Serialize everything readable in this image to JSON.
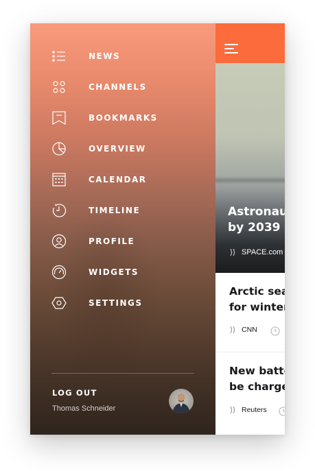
{
  "app": {
    "accent_color": "#fb6b3b"
  },
  "drawer": {
    "items": [
      {
        "label": "NEWS",
        "icon": "list-icon"
      },
      {
        "label": "CHANNELS",
        "icon": "grid-dots-icon"
      },
      {
        "label": "BOOKMARKS",
        "icon": "bookmark-icon"
      },
      {
        "label": "OVERVIEW",
        "icon": "pie-chart-icon"
      },
      {
        "label": "CALENDAR",
        "icon": "calendar-icon"
      },
      {
        "label": "TIMELINE",
        "icon": "history-clock-icon"
      },
      {
        "label": "PROFILE",
        "icon": "user-circle-icon"
      },
      {
        "label": "WIDGETS",
        "icon": "gauge-icon"
      },
      {
        "label": "SETTINGS",
        "icon": "hexagon-gear-icon"
      }
    ],
    "logout_label": "LOG OUT",
    "user_name": "Thomas Schneider"
  },
  "main": {
    "menu_icon": "hamburger-icon",
    "hero": {
      "title_line1": "Astronaut",
      "title_line2": "by 2039",
      "source": "SPACE.com"
    },
    "articles": [
      {
        "title_line1": "Arctic sea",
        "title_line2": "for winter",
        "source": "CNN"
      },
      {
        "title_line1": "New batte",
        "title_line2": "be charge",
        "source": "Reuters"
      }
    ]
  }
}
